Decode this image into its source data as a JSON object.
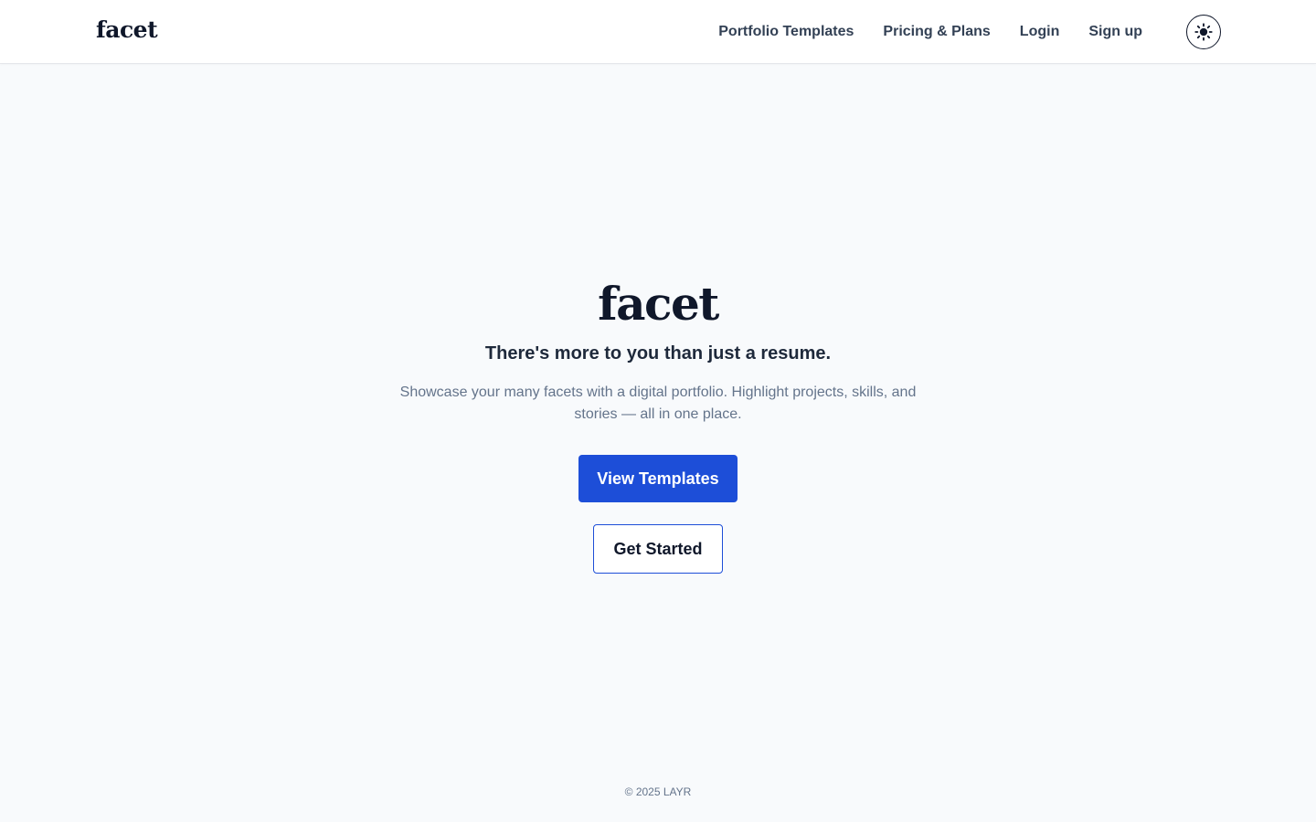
{
  "navbar": {
    "brand": "facet",
    "links": [
      {
        "label": "Portfolio Templates"
      },
      {
        "label": "Pricing & Plans"
      },
      {
        "label": "Login"
      },
      {
        "label": "Sign up"
      }
    ],
    "theme_toggle_icon": "sun-icon"
  },
  "hero": {
    "title": "facet",
    "tagline": "There's more to you than just a resume.",
    "description": "Showcase your many facets with a digital portfolio. Highlight projects, skills, and stories — all in one place.",
    "primary_button": "View Templates",
    "secondary_button": "Get Started"
  },
  "footer": {
    "copyright": "© 2025 LAYR"
  },
  "colors": {
    "accent": "#1d4ed8",
    "background": "#f8fafc",
    "text": "#0f172a",
    "muted": "#64748b"
  }
}
